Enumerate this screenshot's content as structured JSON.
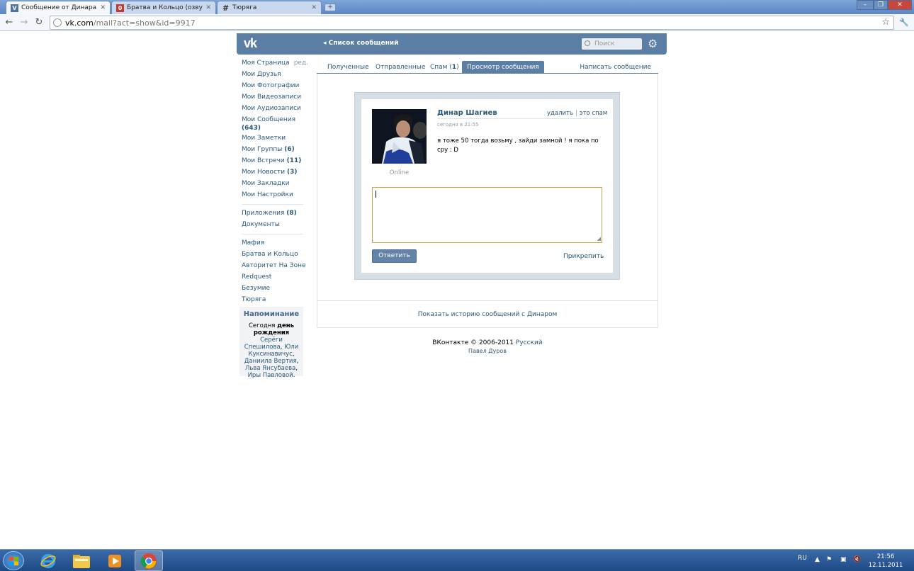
{
  "browser": {
    "tabs": [
      {
        "label": "Сообщение от Динара Ша",
        "favicon": "vk-favicon",
        "active": true
      },
      {
        "label": "Братва и Кольцо (озвучен",
        "favicon": "app-favicon",
        "active": false
      },
      {
        "label": "Тюряга",
        "favicon": "hash-icon",
        "active": false
      }
    ],
    "url_host": "vk.com",
    "url_path": "/mail?act=show&id=9917",
    "colors": {
      "tabbar": "#5d86c4",
      "toolbar": "#f3f6fb"
    }
  },
  "vk": {
    "logo": "vk",
    "back_link": "Список сообщений",
    "search_placeholder": "Поиск",
    "colors": {
      "header": "#5b7ea4",
      "link": "#2b587a"
    }
  },
  "leftmenu": {
    "my_page": "Моя Страница",
    "edit": "ред.",
    "items1": [
      {
        "label": "Мои Друзья",
        "count": ""
      },
      {
        "label": "Мои Фотографии",
        "count": ""
      },
      {
        "label": "Мои Видеозаписи",
        "count": ""
      },
      {
        "label": "Мои Аудиозаписи",
        "count": ""
      },
      {
        "label": "Мои Сообщения",
        "count": "(643)"
      },
      {
        "label": "Мои Заметки",
        "count": ""
      },
      {
        "label": "Мои Группы",
        "count": "(6)"
      },
      {
        "label": "Мои Встречи",
        "count": "(11)"
      },
      {
        "label": "Мои Новости",
        "count": "(3)"
      },
      {
        "label": "Мои Закладки",
        "count": ""
      },
      {
        "label": "Мои Настройки",
        "count": ""
      }
    ],
    "items2": [
      {
        "label": "Приложения",
        "count": "(8)"
      },
      {
        "label": "Документы",
        "count": ""
      }
    ],
    "items3": [
      {
        "label": "Мафия"
      },
      {
        "label": "Братва и Кольцо"
      },
      {
        "label": "Авторитет На Зоне"
      },
      {
        "label": "Redquest"
      },
      {
        "label": "Безумие"
      },
      {
        "label": "Тюряга"
      }
    ]
  },
  "reminder": {
    "title": "Напоминание",
    "t1": "Сегодня ",
    "t2": "день рождения",
    "names": [
      "Серёги Спешилова",
      "Юли Куксинавичус",
      "Даниила Вертия",
      "Льва Янсубаева",
      "Иры Павловой"
    ]
  },
  "mail": {
    "tabs": [
      {
        "label": "Полученные",
        "count": ""
      },
      {
        "label": "Отправленные",
        "count": ""
      },
      {
        "label": "Спам",
        "count": "1"
      },
      {
        "label": "Просмотр сообщения",
        "count": ""
      }
    ],
    "compose": "Написать сообщение",
    "sender": "Динар Шагиев",
    "delete": "удалить",
    "spam": "это спам",
    "date": "сегодня в 21:55",
    "body": "я тоже 50 тогда возьму , зайди замной ! я пока по сру : D",
    "status": "Online",
    "reply_button": "Ответить",
    "attach": "Прикрепить",
    "history_link": "Показать историю сообщений с Динаром"
  },
  "footer": {
    "copyright": "ВКонтакте © 2006-2011",
    "language": "Русский",
    "author": "Павел Дуров"
  },
  "taskbar": {
    "lang": "RU",
    "time": "21:56",
    "date": "12.11.2011"
  }
}
